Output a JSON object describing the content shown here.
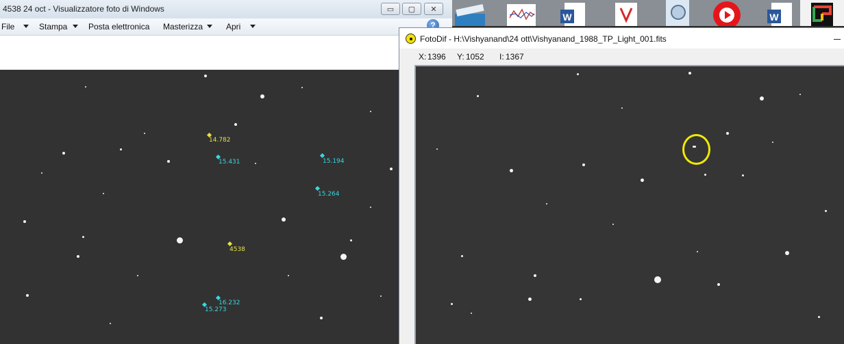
{
  "photo_viewer": {
    "title": "4538 24 oct - Visualizzatore foto di Windows",
    "buttons": {
      "minimize": "▭",
      "maximize": "▢",
      "close": "✕"
    },
    "menu": [
      {
        "label": "File",
        "has_arrow": true
      },
      {
        "label": "Stampa",
        "has_arrow": true
      },
      {
        "label": "Posta elettronica",
        "has_arrow": false
      },
      {
        "label": "Masterizza",
        "has_arrow": true
      },
      {
        "label": "Apri",
        "has_arrow": true
      }
    ],
    "help": "?",
    "markers": [
      {
        "label": "14.782",
        "color": "#e8e040"
      },
      {
        "label": "15.431",
        "color": "#38d8e0"
      },
      {
        "label": "15.194",
        "color": "#38d8e0"
      },
      {
        "label": "15.264",
        "color": "#38d8e0"
      },
      {
        "label": "4538",
        "color": "#e8e040"
      },
      {
        "label": "16.232",
        "color": "#38d8e0"
      },
      {
        "label": "15.273",
        "color": "#38d8e0"
      }
    ]
  },
  "desktop_icons": [
    "scanner-icon",
    "chart-document-icon",
    "word-document-icon",
    "pdf-document-icon",
    "search-document-icon",
    "video-player-icon",
    "word-document-icon",
    "google-icon"
  ],
  "fotodif": {
    "title": "FotoDif - H:\\Vishyanand\\24 ott\\Vishyanand_1988_TP_Light_001.fits",
    "readout": {
      "x_label": "X:",
      "x": "1396",
      "y_label": "Y:",
      "y": "1052",
      "i_label": "I:",
      "i": "1367"
    },
    "highlight_color": "#f0ea00"
  }
}
